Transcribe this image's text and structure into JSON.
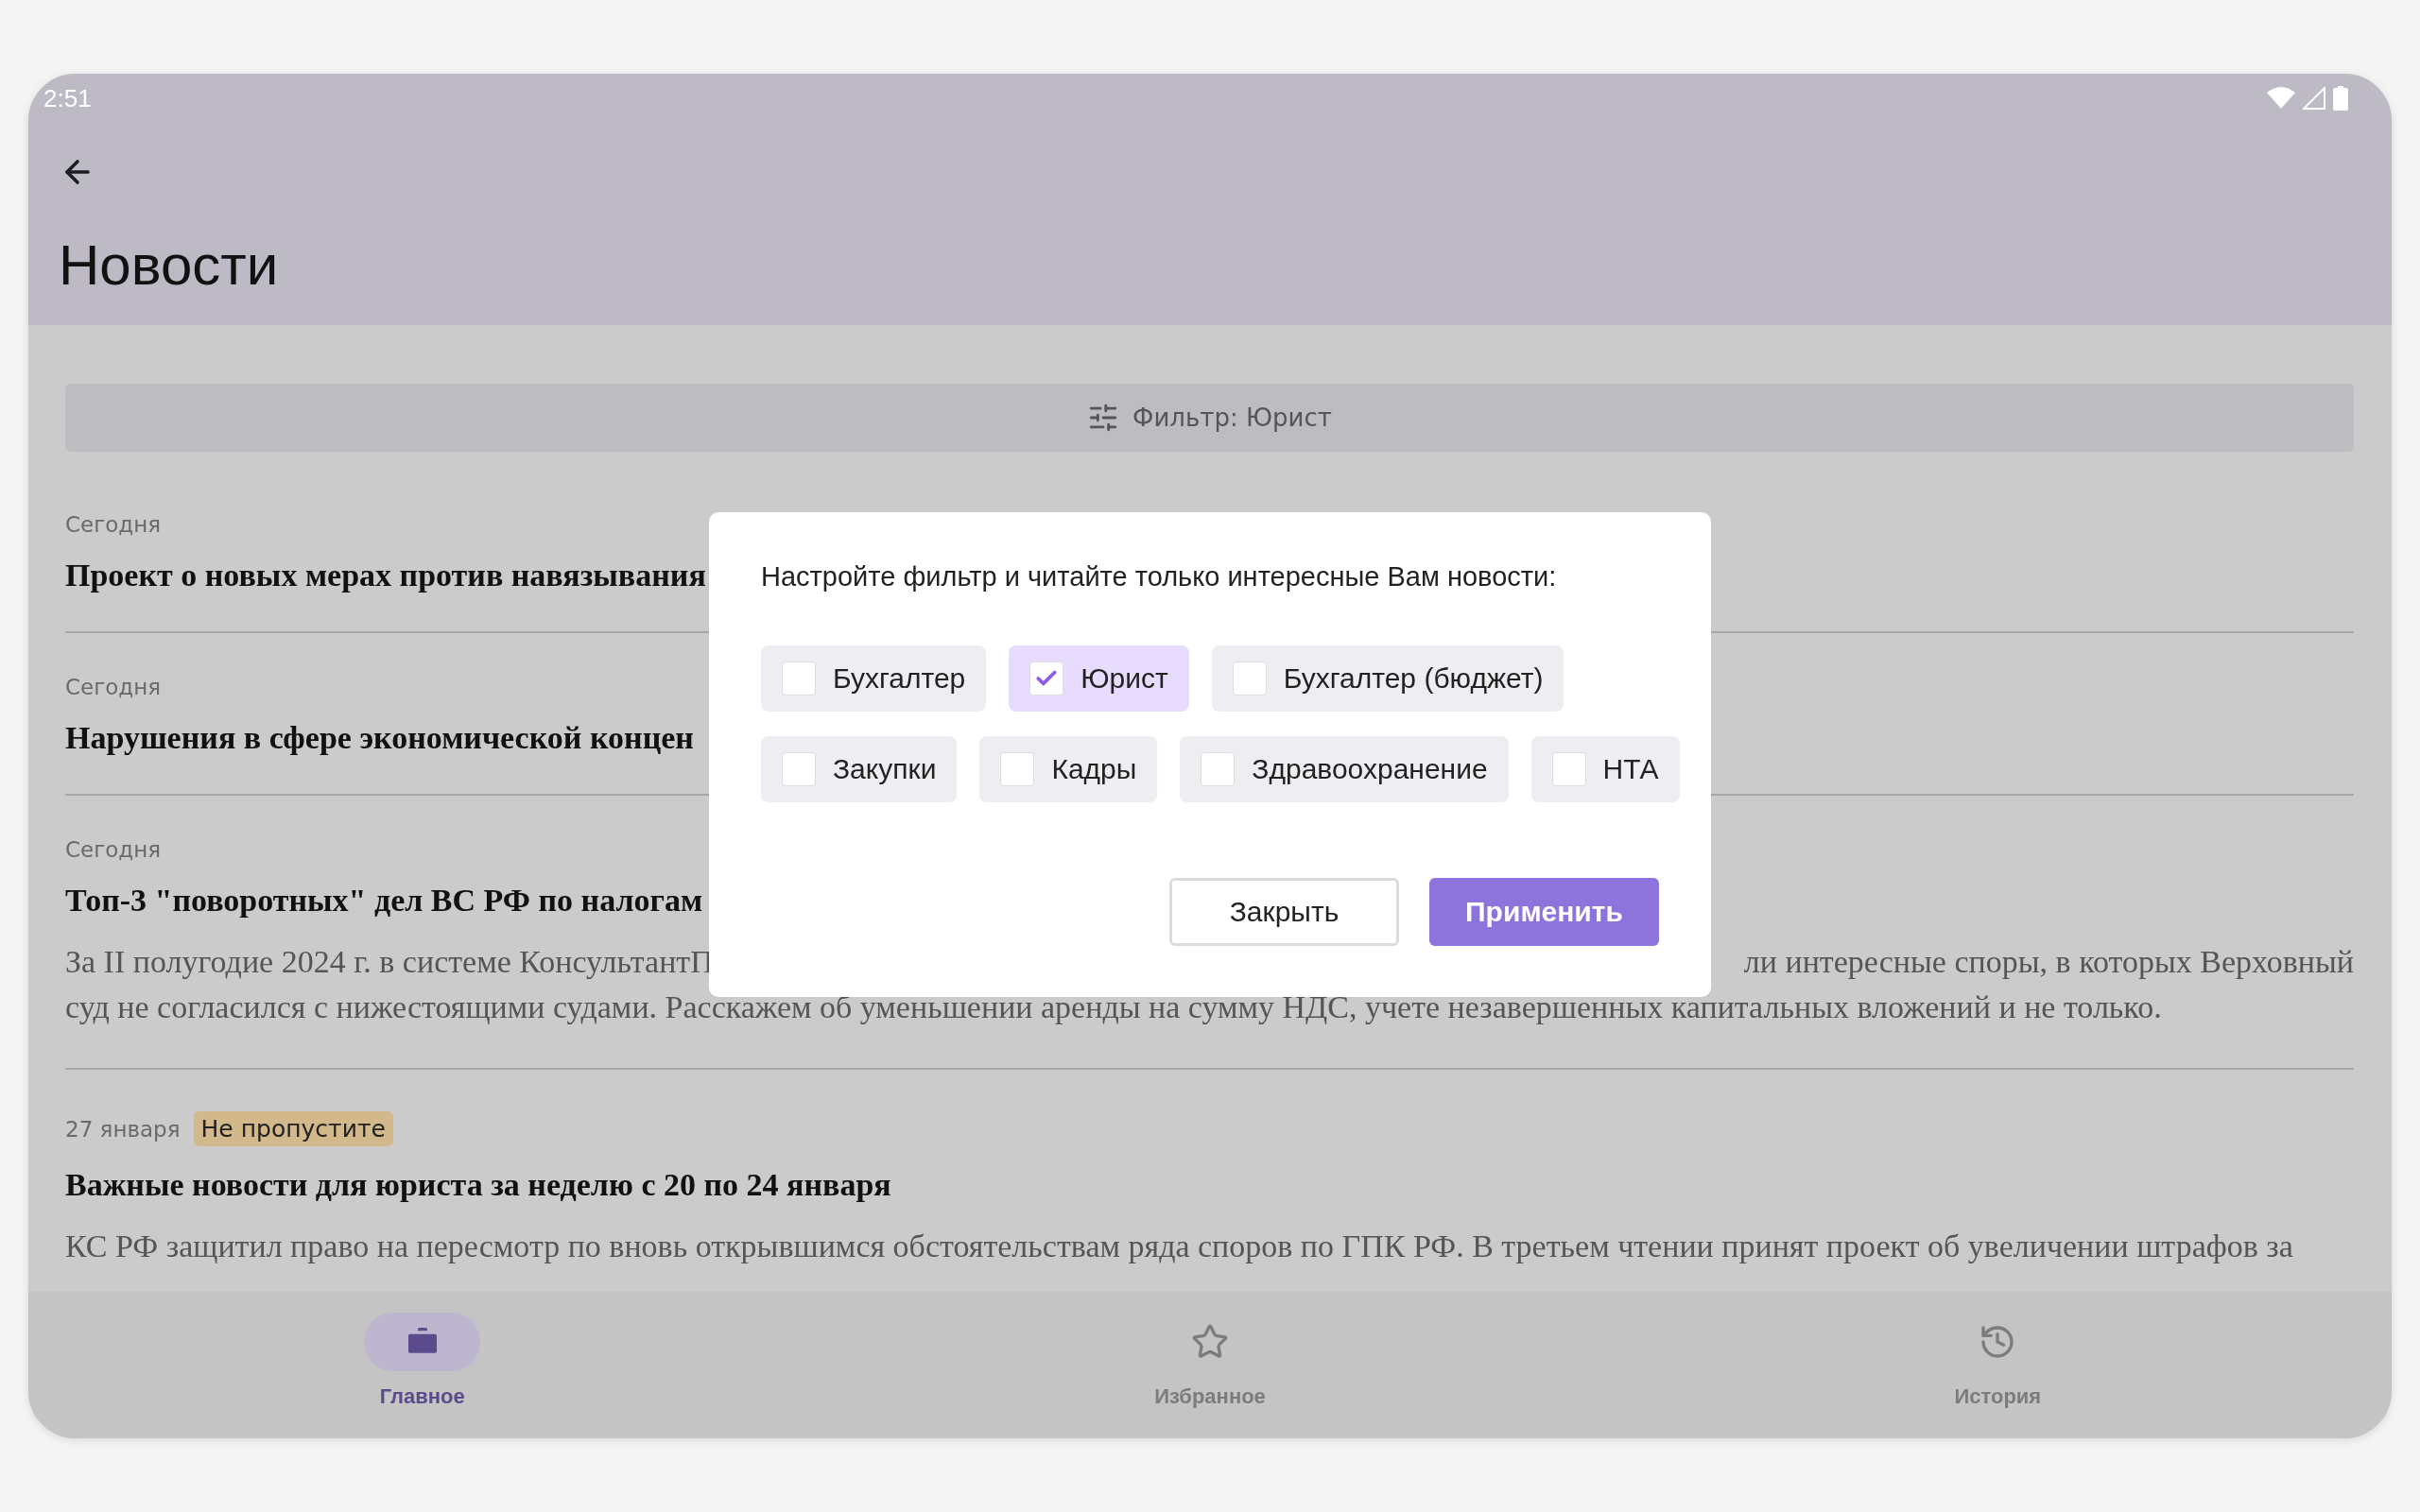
{
  "status_bar": {
    "time": "2:51"
  },
  "app_bar": {
    "title": "Новости"
  },
  "filter_bar": {
    "label": "Фильтр: Юрист"
  },
  "news": [
    {
      "date": "Сегодня",
      "title": "Проект о новых мерах против навязывания"
    },
    {
      "date": "Сегодня",
      "title": "Нарушения в сфере экономической концен"
    },
    {
      "date": "Сегодня",
      "title": "Топ-3 \"поворотных\" дел ВС РФ по налогам",
      "description_lines": [
        [
          "За II полугодие 2024 г. в системе КонсультантП",
          "ли интересные споры, в которых Верховный"
        ],
        [
          "суд не согласился с нижестоящими судами. Расскажем об уменьшении аренды на сумму НДС, учете незавершенных капитальных вложений и не только."
        ]
      ]
    },
    {
      "date": "27 января",
      "badge": "Не пропустите",
      "title": "Важные новости для юриста за неделю с 20 по 24 января",
      "description_lines": [
        [
          "КС РФ защитил право на пересмотр по вновь открывшимся обстоятельствам ряда споров по ГПК РФ. В третьем чтении принят проект об увеличении штрафов за"
        ]
      ]
    }
  ],
  "dialog": {
    "prompt": "Настройте фильтр и читайте только интересные Вам новости:",
    "option_rows": [
      [
        {
          "label": "Бухгалтер",
          "checked": false
        },
        {
          "label": "Юрист",
          "checked": true
        },
        {
          "label": "Бухгалтер (бюджет)",
          "checked": false
        }
      ],
      [
        {
          "label": "Закупки",
          "checked": false
        },
        {
          "label": "Кадры",
          "checked": false
        },
        {
          "label": "Здравоохранение",
          "checked": false
        },
        {
          "label": "НТА",
          "checked": false
        }
      ]
    ],
    "buttons": [
      {
        "label": "Закрыть",
        "kind": "secondary"
      },
      {
        "label": "Применить",
        "kind": "primary"
      }
    ]
  },
  "bottom_nav": [
    {
      "label": "Главное",
      "selected": true
    },
    {
      "label": "Избранное",
      "selected": false
    },
    {
      "label": "История",
      "selected": false
    }
  ]
}
